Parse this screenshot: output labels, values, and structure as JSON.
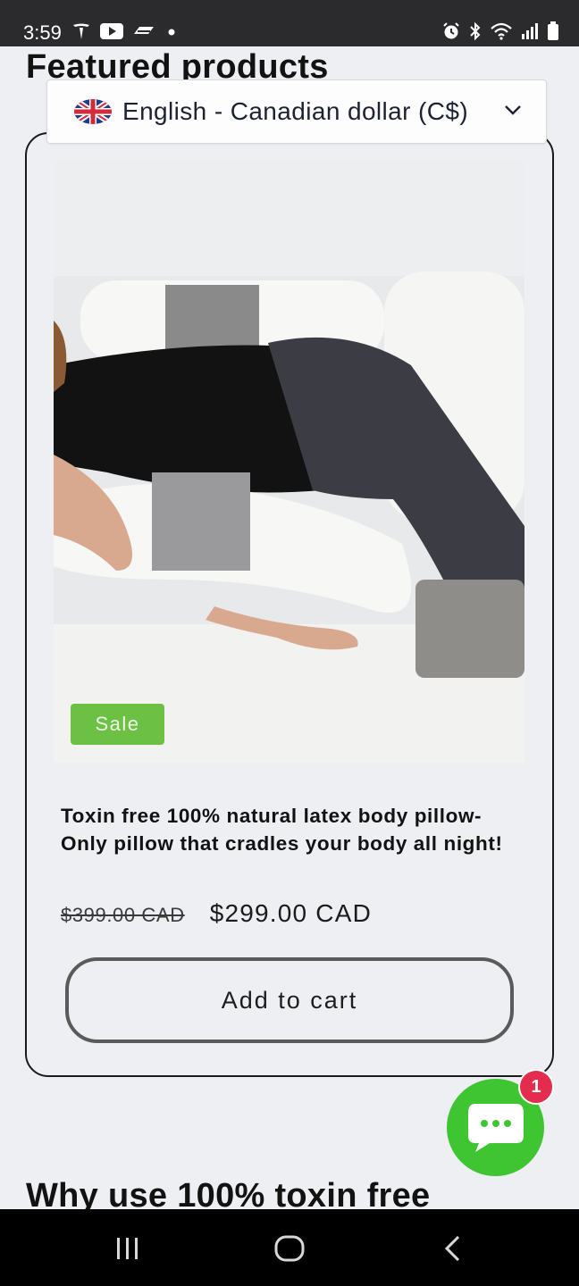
{
  "status_bar": {
    "time": "3:59",
    "left_icons": [
      "tesla-icon",
      "youtube-icon",
      "gmail-icon",
      "dot-icon"
    ],
    "right_icons": [
      "alarm-icon",
      "bluetooth-icon",
      "wifi-icon",
      "signal-icon",
      "battery-icon"
    ]
  },
  "section": {
    "title": "Featured products",
    "next_title": "Why use 100% toxin free"
  },
  "language_selector": {
    "flag": "uk-flag-icon",
    "label": "English - Canadian dollar (C$)"
  },
  "product": {
    "badge": "Sale",
    "title": "Toxin free 100% natural latex body pillow- Only pillow that cradles your body all night!",
    "regular_price": "$399.00 CAD",
    "sale_price": "$299.00 CAD",
    "add_to_cart": "Add to cart"
  },
  "chat": {
    "badge_count": "1",
    "colors": {
      "bubble": "#3ec531",
      "badge": "#e42c4e"
    }
  },
  "colors": {
    "sale_badge": "#6cc144",
    "background": "#eeeff3"
  },
  "nav_bar": {
    "buttons": [
      "recent-apps-icon",
      "home-icon",
      "back-icon"
    ]
  }
}
